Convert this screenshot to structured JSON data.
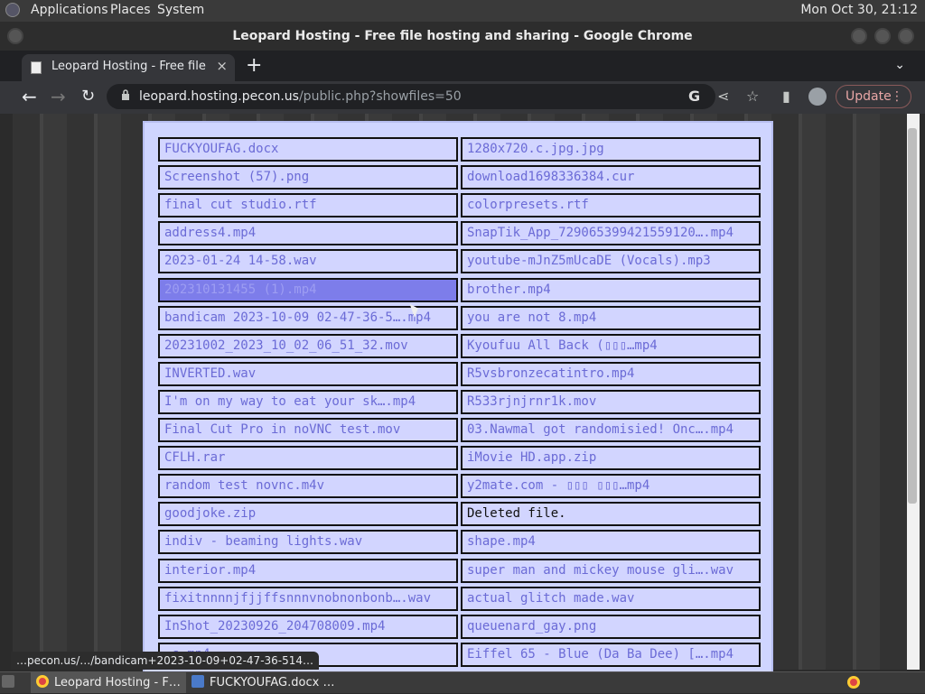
{
  "topbar": {
    "menus": [
      "Applications",
      "Places",
      "System"
    ],
    "clock": "Mon Oct 30, 21:12"
  },
  "window": {
    "title": "Leopard Hosting - Free file hosting and sharing - Google Chrome"
  },
  "tab": {
    "label": "Leopard Hosting - Free file ho",
    "close": "×",
    "new_tab": "+"
  },
  "toolbar": {
    "url_domain": "leopard.hosting.pecon.us",
    "url_path": "/public.php?showfiles=50",
    "update_label": "Update"
  },
  "files": [
    {
      "left": "FUCKYOUFAG.docx",
      "right": "1280x720.c.jpg.jpg"
    },
    {
      "left": "Screenshot (57).png",
      "right": "download1698336384.cur"
    },
    {
      "left": "final cut studio.rtf",
      "right": "colorpresets.rtf"
    },
    {
      "left": "address4.mp4",
      "right": "SnapTik_App_729065399421559120….mp4"
    },
    {
      "left": "2023-01-24 14-58.wav",
      "right": "youtube-mJnZ5mUcaDE (Vocals).mp3"
    },
    {
      "left": "202310131455 (1).mp4",
      "right": "brother.mp4"
    },
    {
      "left": "bandicam 2023-10-09 02-47-36-5….mp4",
      "right": "you are not 8.mp4"
    },
    {
      "left": "20231002_2023_10_02_06_51_32.mov",
      "right": "Kyoufuu All Back (▯▯▯…mp4"
    },
    {
      "left": "INVERTED.wav",
      "right": "R5vsbronzecatintro.mp4"
    },
    {
      "left": "I'm on my way to eat your sk….mp4",
      "right": "R533rjnjrnr1k.mov"
    },
    {
      "left": "Final Cut Pro in noVNC test.mov",
      "right": "03.Nawmal got randomisied! Onc….mp4"
    },
    {
      "left": "CFLH.rar",
      "right": "iMovie HD.app.zip"
    },
    {
      "left": "random test novnc.m4v",
      "right": "y2mate.com - ▯▯▯ ▯▯▯…mp4"
    },
    {
      "left": "goodjoke.zip",
      "right": "Deleted file."
    },
    {
      "left": "indiv - beaming lights.wav",
      "right": "shape.mp4"
    },
    {
      "left": "interior.mp4",
      "right": "super man and mickey mouse gli….wav"
    },
    {
      "left": "fixitnnnnjfjjffsnnnvnobnonbonb….wav",
      "right": "actual glitch made.wav"
    },
    {
      "left": "InShot_20230926_204708009.mp4",
      "right": "queuenard_gay.png"
    },
    {
      "left": "…s.mp4",
      "right": "Eiffel 65 - Blue (Da Ba Dee) [….mp4"
    }
  ],
  "status": {
    "hover_url": "…pecon.us/…/bandicam+2023-10-09+02-47-36-514…"
  },
  "taskbar": {
    "items": [
      "Leopard Hosting - F…",
      "FUCKYOUFAG.docx …"
    ]
  }
}
